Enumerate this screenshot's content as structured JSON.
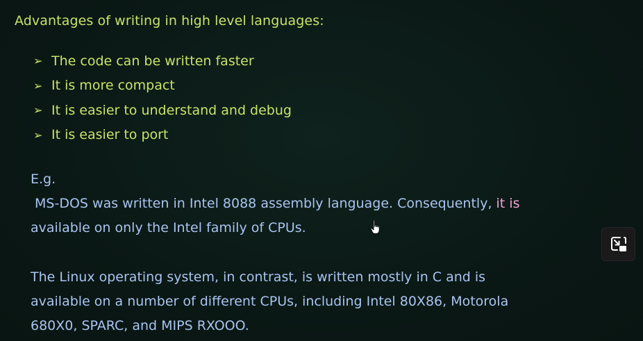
{
  "slide": {
    "heading": "Advantages of writing in high level languages:",
    "bullet_marker": "➢",
    "bullets": [
      "The code can be written faster",
      "It is more compact",
      "It is easier to understand and debug",
      "It is easier to port"
    ],
    "example_label": "E.g.",
    "msdos_line1_main": " MS-DOS was written in Intel 8088 assembly language. Consequently, ",
    "msdos_line1_highlight": "it is",
    "msdos_line2": "available on only the Intel family of CPUs.",
    "linux_lines": [
      "The Linux operating system, in contrast, is written mostly in C and is",
      "available on a number of different CPUs, including Intel 80X86, Motorola",
      "680X0, SPARC, and MIPS RXOOO."
    ]
  },
  "colors": {
    "background": "#0b1a16",
    "heading_text": "#c9e36a",
    "body_text": "#a9c4f0",
    "highlight_text": "#f2a2d8"
  },
  "icons": {
    "cursor": "hand-pointer-icon",
    "pip": "exit-picture-in-picture-icon"
  }
}
